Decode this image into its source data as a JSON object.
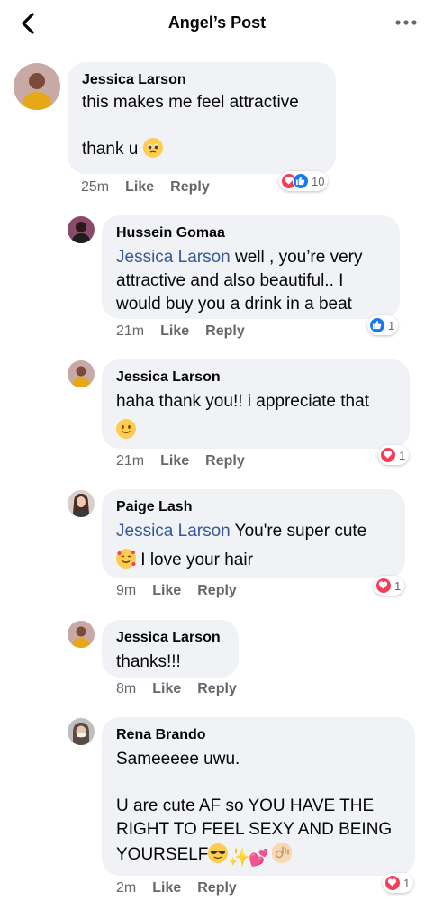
{
  "header": {
    "title": "Angel’s Post",
    "back_icon": "chevron-left-icon",
    "more_icon": "ellipsis-icon"
  },
  "comments": [
    {
      "author": "Jessica Larson",
      "line1": "this makes me feel attractive",
      "line2": "thank u",
      "emoji": "pleading-face-emoji",
      "time": "25m",
      "like": "Like",
      "reply": "Reply",
      "reactions": [
        "love",
        "like"
      ],
      "reaction_count": "10"
    },
    {
      "author": "Hussein Gomaa",
      "mention": "Jessica Larson",
      "line1": " well , you’re very",
      "line2": "attractive and also beautiful.. I",
      "line3": "would buy you a drink in a beat",
      "time": "21m",
      "like": "Like",
      "reply": "Reply",
      "reactions": [
        "like"
      ],
      "reaction_count": "1"
    },
    {
      "author": "Jessica Larson",
      "line1": "haha thank you!! i appreciate that",
      "emoji": "slightly-smiling-face-emoji",
      "time": "21m",
      "like": "Like",
      "reply": "Reply",
      "reactions": [
        "love"
      ],
      "reaction_count": "1"
    },
    {
      "author": "Paige Lash",
      "mention": "Jessica Larson",
      "line1": " You're super cute",
      "line2": " I love your hair",
      "emoji": "smiling-face-with-hearts-emoji",
      "time": "9m",
      "like": "Like",
      "reply": "Reply",
      "reactions": [
        "love"
      ],
      "reaction_count": "1"
    },
    {
      "author": "Jessica Larson",
      "line1": "thanks!!!",
      "time": "8m",
      "like": "Like",
      "reply": "Reply"
    },
    {
      "author": "Rena Brando",
      "line1": "Sameeeee uwu.",
      "line2": "U are cute AF so YOU HAVE THE",
      "line3": "RIGHT TO FEEL SEXY AND BEING",
      "line4": "YOURSELF",
      "emojis": [
        "sunglasses-face-emoji",
        "sparkles-emoji",
        "two-hearts-emoji",
        "ok-hand-emoji"
      ],
      "time": "2m",
      "like": "Like",
      "reply": "Reply",
      "reactions": [
        "love"
      ],
      "reaction_count": "1"
    }
  ],
  "colors": {
    "bubble": "#f0f2f5",
    "mention": "#385898",
    "meta": "#65676b",
    "love": "#f33e58",
    "like": "#1877f2"
  }
}
